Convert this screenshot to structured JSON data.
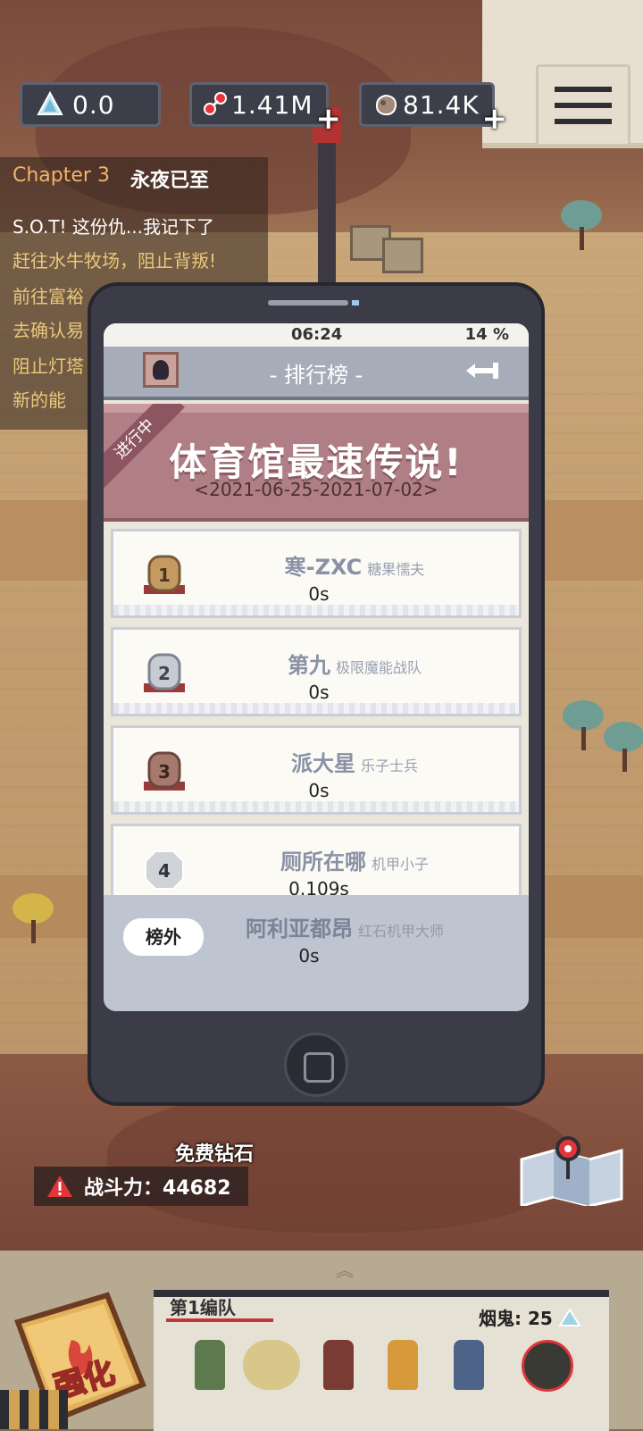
{
  "hud": {
    "crystal": "0.0",
    "parts": "1.41M",
    "ore": "81.4K",
    "plus": "+"
  },
  "quest_log": {
    "chapter": "Chapter 3",
    "chapter_title": "永夜已至",
    "quests": [
      {
        "text": "S.O.T!  这份仇...我记下了",
        "color": "#ffffff"
      },
      {
        "text": "赶往水牛牧场，阻止背叛!",
        "color": "#e9c77a"
      },
      {
        "text": "前往富裕",
        "color": "#e9c77a"
      },
      {
        "text": "去确认易",
        "color": "#e9c77a"
      },
      {
        "text": "阻止灯塔",
        "color": "#e9c77a"
      },
      {
        "text": "新的能",
        "color": "#e9c77a"
      }
    ]
  },
  "phone": {
    "time": "06:24",
    "battery": "14 %",
    "title": "- 排行榜 -",
    "event": {
      "ribbon": "进行中",
      "title": "体育馆最速传说!",
      "dates": "<2021-06-25-2021-07-02>"
    },
    "rankings": [
      {
        "rank": "1",
        "name": "寒-ZXC",
        "team": "糖果懦夫",
        "score": "0s",
        "medal_color": "#c49a62",
        "medal_dark": "#9a3b3b"
      },
      {
        "rank": "2",
        "name": "第九",
        "team": "极限魔能战队",
        "score": "0s",
        "medal_color": "#c7cbd2",
        "medal_dark": "#9a3b3b"
      },
      {
        "rank": "3",
        "name": "派大星",
        "team": "乐子士兵",
        "score": "0s",
        "medal_color": "#a7786e",
        "medal_dark": "#9a3b3b"
      },
      {
        "rank": "4",
        "name": "厕所在哪",
        "team": "机甲小子",
        "score": "0.109s",
        "medal_color": "#d0d3d8",
        "medal_dark": "#d0d3d8"
      }
    ],
    "my_rank": {
      "badge": "榜外",
      "name": "阿利亚都昂",
      "team": "红石机甲大师",
      "score": "0s"
    }
  },
  "bottom": {
    "free_diamond": "免费钻石",
    "power": "战斗力：44682",
    "team_name": "第1编队",
    "smoker": "烟鬼: 25",
    "enhance": "强化"
  },
  "colors": {
    "accent_red": "#c0373b",
    "chapter_orange": "#f2b36b",
    "hud_dark": "#3c3f4a"
  }
}
